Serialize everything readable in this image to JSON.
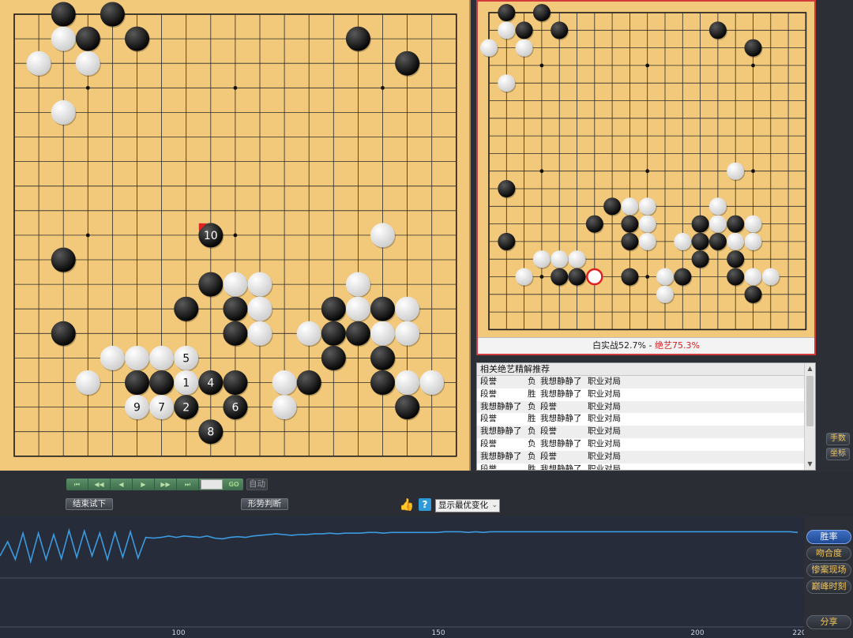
{
  "main_board": {
    "size": 19,
    "stones": [
      {
        "c": "B",
        "x": 3,
        "y": 1
      },
      {
        "c": "B",
        "x": 5,
        "y": 1
      },
      {
        "c": "W",
        "x": 3,
        "y": 2
      },
      {
        "c": "B",
        "x": 4,
        "y": 2
      },
      {
        "c": "B",
        "x": 6,
        "y": 2
      },
      {
        "c": "B",
        "x": 15,
        "y": 2
      },
      {
        "c": "W",
        "x": 2,
        "y": 3
      },
      {
        "c": "W",
        "x": 4,
        "y": 3
      },
      {
        "c": "B",
        "x": 17,
        "y": 3
      },
      {
        "c": "W",
        "x": 3,
        "y": 5
      },
      {
        "c": "B",
        "x": 9,
        "y": 10,
        "n": "10"
      },
      {
        "c": "W",
        "x": 16,
        "y": 10
      },
      {
        "c": "B",
        "x": 3,
        "y": 11
      },
      {
        "c": "B",
        "x": 9,
        "y": 12
      },
      {
        "c": "W",
        "x": 10,
        "y": 12
      },
      {
        "c": "W",
        "x": 11,
        "y": 12
      },
      {
        "c": "W",
        "x": 15,
        "y": 12
      },
      {
        "c": "B",
        "x": 8,
        "y": 13
      },
      {
        "c": "B",
        "x": 10,
        "y": 13
      },
      {
        "c": "W",
        "x": 11,
        "y": 13
      },
      {
        "c": "B",
        "x": 14,
        "y": 13
      },
      {
        "c": "W",
        "x": 15,
        "y": 13
      },
      {
        "c": "B",
        "x": 16,
        "y": 13
      },
      {
        "c": "W",
        "x": 17,
        "y": 13
      },
      {
        "c": "B",
        "x": 3,
        "y": 14
      },
      {
        "c": "B",
        "x": 10,
        "y": 14
      },
      {
        "c": "W",
        "x": 11,
        "y": 14
      },
      {
        "c": "W",
        "x": 13,
        "y": 14
      },
      {
        "c": "B",
        "x": 14,
        "y": 14
      },
      {
        "c": "B",
        "x": 15,
        "y": 14
      },
      {
        "c": "W",
        "x": 16,
        "y": 14
      },
      {
        "c": "W",
        "x": 17,
        "y": 14
      },
      {
        "c": "W",
        "x": 5,
        "y": 15
      },
      {
        "c": "W",
        "x": 6,
        "y": 15
      },
      {
        "c": "W",
        "x": 7,
        "y": 15
      },
      {
        "c": "W",
        "x": 8,
        "y": 15,
        "n": "5"
      },
      {
        "c": "B",
        "x": 14,
        "y": 15
      },
      {
        "c": "B",
        "x": 16,
        "y": 15
      },
      {
        "c": "W",
        "x": 4,
        "y": 16
      },
      {
        "c": "B",
        "x": 6,
        "y": 16
      },
      {
        "c": "B",
        "x": 7,
        "y": 16
      },
      {
        "c": "W",
        "x": 8,
        "y": 16,
        "n": "1"
      },
      {
        "c": "B",
        "x": 9,
        "y": 16,
        "n": "4"
      },
      {
        "c": "B",
        "x": 10,
        "y": 16
      },
      {
        "c": "W",
        "x": 12,
        "y": 16
      },
      {
        "c": "B",
        "x": 13,
        "y": 16
      },
      {
        "c": "B",
        "x": 16,
        "y": 16
      },
      {
        "c": "W",
        "x": 17,
        "y": 16
      },
      {
        "c": "W",
        "x": 18,
        "y": 16
      },
      {
        "c": "W",
        "x": 6,
        "y": 17,
        "n": "9"
      },
      {
        "c": "W",
        "x": 7,
        "y": 17,
        "n": "7"
      },
      {
        "c": "B",
        "x": 8,
        "y": 17,
        "n": "2"
      },
      {
        "c": "B",
        "x": 10,
        "y": 17,
        "n": "6"
      },
      {
        "c": "W",
        "x": 12,
        "y": 17
      },
      {
        "c": "B",
        "x": 17,
        "y": 17
      },
      {
        "c": "B",
        "x": 9,
        "y": 18,
        "n": "8"
      }
    ]
  },
  "preview_board": {
    "size": 19,
    "stones": [
      {
        "c": "B",
        "x": 2,
        "y": 1
      },
      {
        "c": "B",
        "x": 4,
        "y": 1
      },
      {
        "c": "W",
        "x": 2,
        "y": 2
      },
      {
        "c": "B",
        "x": 3,
        "y": 2
      },
      {
        "c": "B",
        "x": 5,
        "y": 2
      },
      {
        "c": "B",
        "x": 14,
        "y": 2
      },
      {
        "c": "W",
        "x": 1,
        "y": 3
      },
      {
        "c": "W",
        "x": 3,
        "y": 3
      },
      {
        "c": "B",
        "x": 16,
        "y": 3
      },
      {
        "c": "W",
        "x": 2,
        "y": 5
      },
      {
        "c": "W",
        "x": 15,
        "y": 10
      },
      {
        "c": "B",
        "x": 2,
        "y": 11
      },
      {
        "c": "B",
        "x": 8,
        "y": 12
      },
      {
        "c": "W",
        "x": 9,
        "y": 12
      },
      {
        "c": "W",
        "x": 10,
        "y": 12
      },
      {
        "c": "W",
        "x": 14,
        "y": 12
      },
      {
        "c": "B",
        "x": 7,
        "y": 13
      },
      {
        "c": "B",
        "x": 9,
        "y": 13
      },
      {
        "c": "W",
        "x": 10,
        "y": 13
      },
      {
        "c": "B",
        "x": 13,
        "y": 13
      },
      {
        "c": "W",
        "x": 14,
        "y": 13
      },
      {
        "c": "B",
        "x": 15,
        "y": 13
      },
      {
        "c": "W",
        "x": 16,
        "y": 13
      },
      {
        "c": "B",
        "x": 2,
        "y": 14
      },
      {
        "c": "B",
        "x": 9,
        "y": 14
      },
      {
        "c": "W",
        "x": 10,
        "y": 14
      },
      {
        "c": "W",
        "x": 12,
        "y": 14
      },
      {
        "c": "B",
        "x": 13,
        "y": 14
      },
      {
        "c": "B",
        "x": 14,
        "y": 14
      },
      {
        "c": "W",
        "x": 15,
        "y": 14
      },
      {
        "c": "W",
        "x": 16,
        "y": 14
      },
      {
        "c": "W",
        "x": 4,
        "y": 15
      },
      {
        "c": "W",
        "x": 5,
        "y": 15
      },
      {
        "c": "W",
        "x": 6,
        "y": 15
      },
      {
        "c": "B",
        "x": 13,
        "y": 15
      },
      {
        "c": "B",
        "x": 15,
        "y": 15
      },
      {
        "c": "W",
        "x": 3,
        "y": 16
      },
      {
        "c": "B",
        "x": 5,
        "y": 16
      },
      {
        "c": "B",
        "x": 6,
        "y": 16
      },
      {
        "c": "B",
        "x": 9,
        "y": 16
      },
      {
        "c": "W",
        "x": 11,
        "y": 16
      },
      {
        "c": "B",
        "x": 12,
        "y": 16
      },
      {
        "c": "B",
        "x": 15,
        "y": 16
      },
      {
        "c": "W",
        "x": 16,
        "y": 16
      },
      {
        "c": "W",
        "x": 17,
        "y": 16
      },
      {
        "c": "W",
        "x": 11,
        "y": 17
      },
      {
        "c": "B",
        "x": 16,
        "y": 17
      }
    ],
    "marker": {
      "x": 7,
      "y": 16
    },
    "caption_prefix": "白实战52.7% - ",
    "caption_highlight": "绝艺75.3%"
  },
  "list": {
    "header": "相关绝艺精解推荐",
    "rows": [
      [
        "段誉",
        "负",
        "我想静静了",
        "职业对局"
      ],
      [
        "段誉",
        "胜",
        "我想静静了",
        "职业对局"
      ],
      [
        "我想静静了",
        "负",
        "段誉",
        "职业对局"
      ],
      [
        "段誉",
        "胜",
        "我想静静了",
        "职业对局"
      ],
      [
        "我想静静了",
        "负",
        "段誉",
        "职业对局"
      ],
      [
        "段誉",
        "负",
        "我想静静了",
        "职业对局"
      ],
      [
        "我想静静了",
        "负",
        "段誉",
        "职业对局"
      ],
      [
        "段誉",
        "胜",
        "我想静静了",
        "职业对局"
      ]
    ]
  },
  "side_buttons": {
    "moves": "手数",
    "coords": "坐标"
  },
  "controls": {
    "auto": "自动",
    "go": "GO",
    "end_trial": "结束试下",
    "judge": "形势判断",
    "help": "?",
    "select_value": "显示最优变化"
  },
  "graph_buttons": {
    "winrate": "胜率",
    "match": "吻合度",
    "blunder": "惨案现场",
    "peak": "巅峰时刻",
    "share": "分享"
  },
  "graph": {
    "x_ticks": [
      "100",
      "150",
      "200",
      "220"
    ],
    "winrate_series": [
      40,
      20,
      45,
      8,
      48,
      8,
      45,
      10,
      44,
      4,
      42,
      5,
      40,
      8,
      45,
      7,
      42,
      6,
      43,
      14,
      15,
      14,
      12,
      14,
      12,
      13,
      14,
      12,
      15,
      16,
      14,
      13,
      14,
      12,
      11,
      10,
      9,
      10,
      11,
      10,
      10,
      9,
      9,
      8,
      9,
      8,
      8,
      8,
      7,
      7,
      8,
      7,
      7,
      7,
      7,
      7,
      7,
      7,
      6,
      6,
      6,
      7,
      6,
      7,
      6,
      6,
      6,
      6,
      6,
      6,
      6,
      6,
      6,
      6,
      6,
      6,
      6,
      6,
      6,
      6,
      6,
      6,
      6,
      6,
      6,
      6,
      6,
      6,
      6,
      6,
      6,
      6,
      6,
      6,
      6,
      6,
      6,
      6,
      6,
      6,
      6,
      6,
      6,
      6,
      7
    ]
  },
  "colors": {
    "board": "#f2c97a",
    "accent_red": "#d62020",
    "graph_line": "#3b9be0"
  }
}
